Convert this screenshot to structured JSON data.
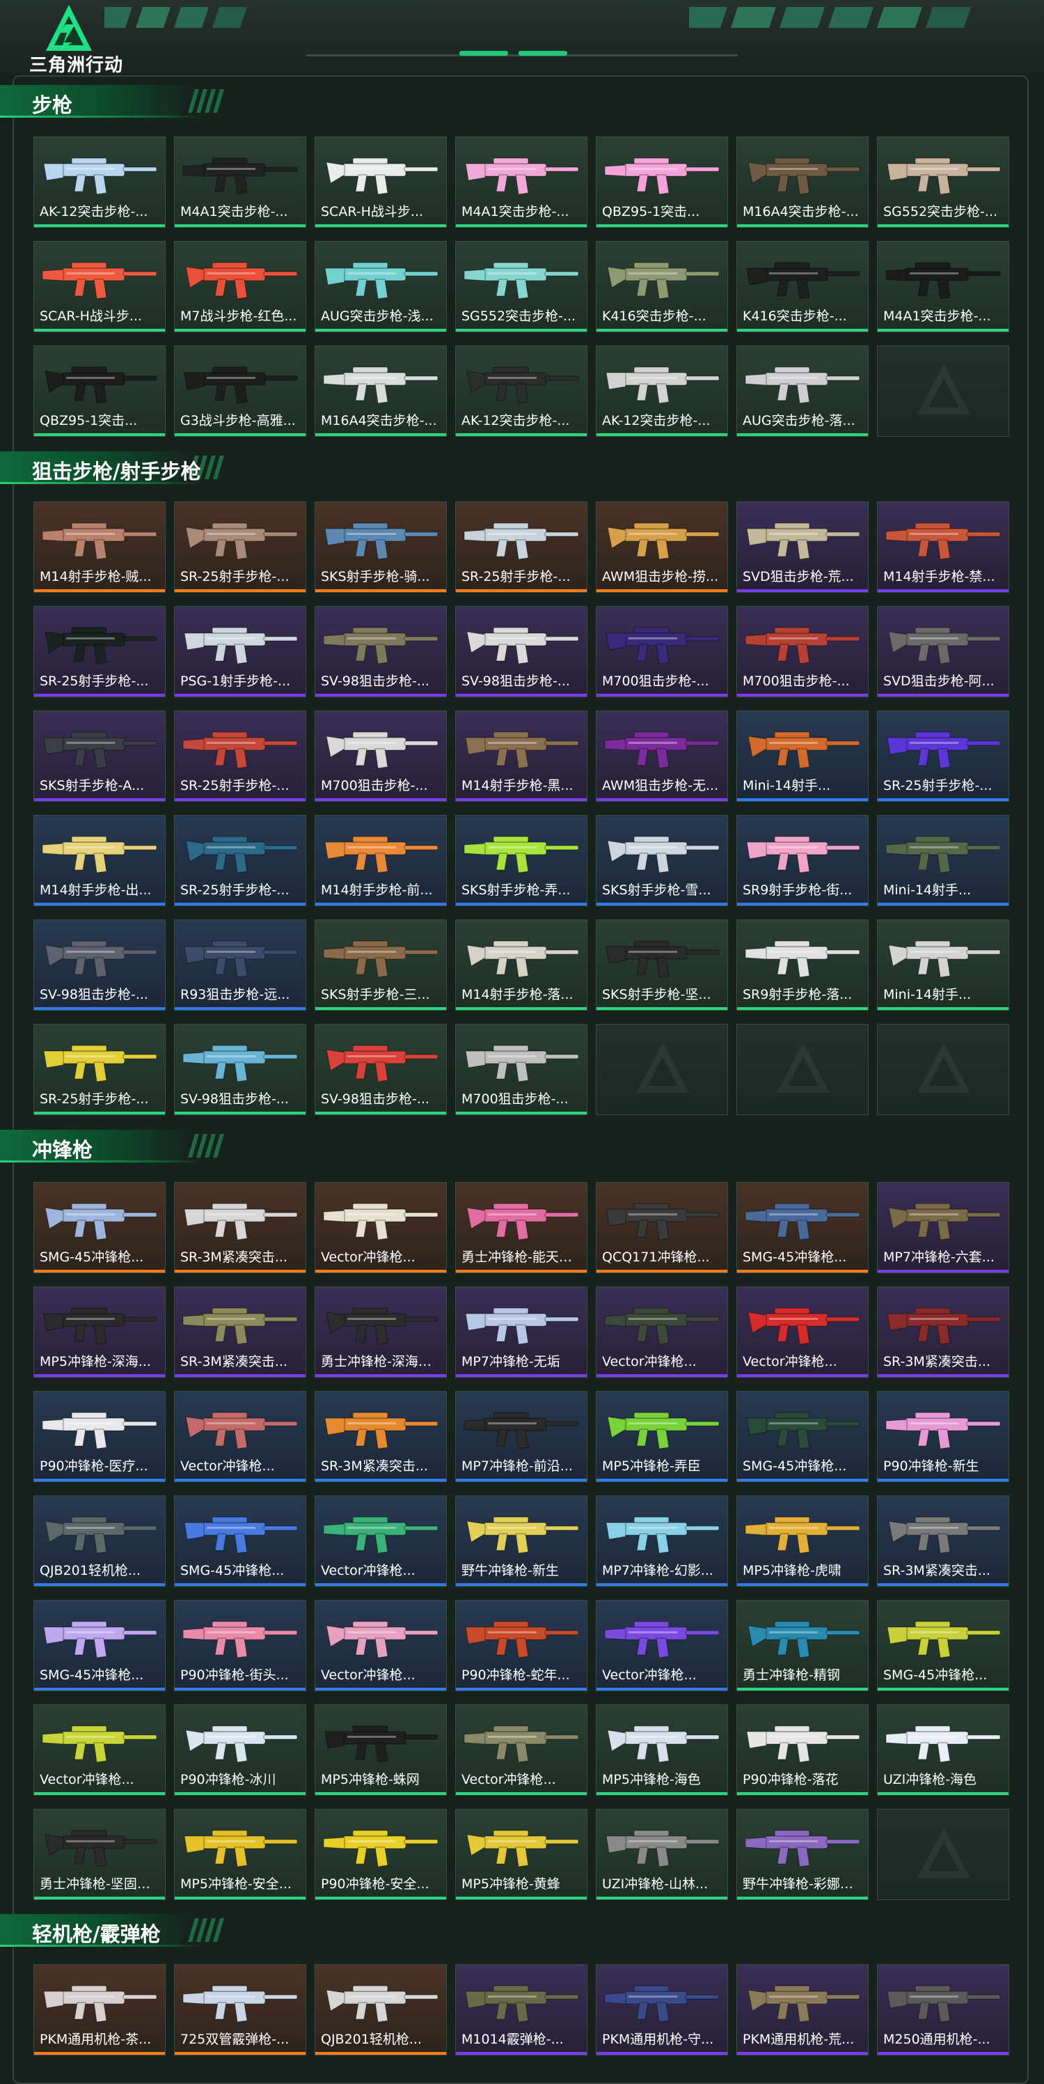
{
  "brand": {
    "logo_text": "三角洲行动"
  },
  "colors": {
    "green": "#2ed37e",
    "orange": "#ff7a18",
    "purple": "#7a3cf0",
    "blue": "#2f7cf0",
    "accent": "#1fe085"
  },
  "sections": [
    {
      "title": "步枪",
      "items": [
        {
          "label": "AK-12突击步枪-...",
          "rarity": "green",
          "color": "#b9d6ee"
        },
        {
          "label": "M4A1突击步枪-...",
          "rarity": "green",
          "color": "#202224"
        },
        {
          "label": "SCAR-H战斗步...",
          "rarity": "green",
          "color": "#e8ecec"
        },
        {
          "label": "M4A1突击步枪-...",
          "rarity": "green",
          "color": "#f0a8d6"
        },
        {
          "label": "QBZ95-1突击...",
          "rarity": "green",
          "color": "#f4a4d8"
        },
        {
          "label": "M16A4突击步枪-...",
          "rarity": "green",
          "color": "#6f5b44"
        },
        {
          "label": "SG552突击步枪-...",
          "rarity": "green",
          "color": "#c9b39e"
        },
        {
          "label": "SCAR-H战斗步...",
          "rarity": "green",
          "color": "#ee5a3f"
        },
        {
          "label": "M7战斗步枪-红色...",
          "rarity": "green",
          "color": "#e94f3a"
        },
        {
          "label": "AUG突击步枪-浅...",
          "rarity": "green",
          "color": "#74d1d1"
        },
        {
          "label": "SG552突击步枪-...",
          "rarity": "green",
          "color": "#86d6cf"
        },
        {
          "label": "K416突击步枪-...",
          "rarity": "green",
          "color": "#8d9a72"
        },
        {
          "label": "K416突击步枪-...",
          "rarity": "green",
          "color": "#1d1f20"
        },
        {
          "label": "M4A1突击步枪-...",
          "rarity": "green",
          "color": "#1a1c1d"
        },
        {
          "label": "QBZ95-1突击...",
          "rarity": "green",
          "color": "#1b1d1e"
        },
        {
          "label": "G3战斗步枪-高雅...",
          "rarity": "green",
          "color": "#1c1e1f"
        },
        {
          "label": "M16A4突击步枪-...",
          "rarity": "green",
          "color": "#d8dcdc"
        },
        {
          "label": "AK-12突击步枪-...",
          "rarity": "green",
          "color": "#2a2c2d"
        },
        {
          "label": "AK-12突击步枪-...",
          "rarity": "green",
          "color": "#d3d3d6"
        },
        {
          "label": "AUG突击步枪-落...",
          "rarity": "green",
          "color": "#cfcfd3"
        },
        {
          "label": "",
          "rarity": "empty",
          "color": ""
        }
      ]
    },
    {
      "title": "狙击步枪/射手步枪",
      "items": [
        {
          "label": "M14射手步枪-贼...",
          "rarity": "orange",
          "color": "#b9826c"
        },
        {
          "label": "SR-25射手步枪-...",
          "rarity": "orange",
          "color": "#a88b78"
        },
        {
          "label": "SKS射手步枪-骑...",
          "rarity": "orange",
          "color": "#5c88b2"
        },
        {
          "label": "SR-25射手步枪-...",
          "rarity": "orange",
          "color": "#c9d3dc"
        },
        {
          "label": "AWM狙击步枪-捞...",
          "rarity": "orange",
          "color": "#d7a04b"
        },
        {
          "label": "SVD狙击步枪-荒...",
          "rarity": "purple",
          "color": "#c2b89c"
        },
        {
          "label": "M14射手步枪-禁...",
          "rarity": "purple",
          "color": "#c7563b"
        },
        {
          "label": "SR-25射手步枪-...",
          "rarity": "purple",
          "color": "#19231f"
        },
        {
          "label": "PSG-1射手步枪-...",
          "rarity": "purple",
          "color": "#cfd7de"
        },
        {
          "label": "SV-98狙击步枪-...",
          "rarity": "purple",
          "color": "#7e7a5c"
        },
        {
          "label": "SV-98狙击步枪-...",
          "rarity": "purple",
          "color": "#dadada"
        },
        {
          "label": "M700狙击步枪-...",
          "rarity": "purple",
          "color": "#3a2b7a"
        },
        {
          "label": "M700狙击步枪-...",
          "rarity": "purple",
          "color": "#b64034"
        },
        {
          "label": "SVD狙击步枪-阿...",
          "rarity": "purple",
          "color": "#6a6a6a"
        },
        {
          "label": "SKS射手步枪-A...",
          "rarity": "purple",
          "color": "#3a3e46"
        },
        {
          "label": "SR-25射手步枪-...",
          "rarity": "purple",
          "color": "#c4473a"
        },
        {
          "label": "M700狙击步枪-...",
          "rarity": "purple",
          "color": "#d9d9d9"
        },
        {
          "label": "M14射手步枪-黑...",
          "rarity": "purple",
          "color": "#8a7050"
        },
        {
          "label": "AWM狙击步枪-无...",
          "rarity": "purple",
          "color": "#7b2b9a"
        },
        {
          "label": "Mini-14射手...",
          "rarity": "blue",
          "color": "#d36a2e"
        },
        {
          "label": "SR-25射手步枪-...",
          "rarity": "blue",
          "color": "#5b37d8"
        },
        {
          "label": "M14射手步枪-出...",
          "rarity": "blue",
          "color": "#e5d27a"
        },
        {
          "label": "SR-25射手步枪-...",
          "rarity": "blue",
          "color": "#2d6a8a"
        },
        {
          "label": "M14射手步枪-前...",
          "rarity": "blue",
          "color": "#e88a3a"
        },
        {
          "label": "SKS射手步枪-弄...",
          "rarity": "blue",
          "color": "#a8e43c"
        },
        {
          "label": "SKS射手步枪-雪...",
          "rarity": "blue",
          "color": "#cfd6e0"
        },
        {
          "label": "SR9射手步枪-街...",
          "rarity": "blue",
          "color": "#f0a4c8"
        },
        {
          "label": "Mini-14射手...",
          "rarity": "blue",
          "color": "#55684a"
        },
        {
          "label": "SV-98狙击步枪-...",
          "rarity": "blue",
          "color": "#5e6270"
        },
        {
          "label": "R93狙击步枪-远...",
          "rarity": "blue",
          "color": "#3d4a6a"
        },
        {
          "label": "SKS射手步枪-三...",
          "rarity": "green",
          "color": "#8a6a4a"
        },
        {
          "label": "M14射手步枪-落...",
          "rarity": "green",
          "color": "#d6d2c8"
        },
        {
          "label": "SKS射手步枪-坚...",
          "rarity": "green",
          "color": "#2a2a2a"
        },
        {
          "label": "SR9射手步枪-落...",
          "rarity": "green",
          "color": "#e1e1e1"
        },
        {
          "label": "Mini-14射手...",
          "rarity": "green",
          "color": "#d4d4d4"
        },
        {
          "label": "SR-25射手步枪-...",
          "rarity": "green",
          "color": "#e3cf3a"
        },
        {
          "label": "SV-98狙击步枪-...",
          "rarity": "green",
          "color": "#6ab4d6"
        },
        {
          "label": "SV-98狙击步枪-...",
          "rarity": "green",
          "color": "#d8423a"
        },
        {
          "label": "M700狙击步枪-...",
          "rarity": "green",
          "color": "#bfbfbf"
        },
        {
          "label": "",
          "rarity": "empty",
          "color": ""
        },
        {
          "label": "",
          "rarity": "empty",
          "color": ""
        },
        {
          "label": "",
          "rarity": "empty",
          "color": ""
        }
      ]
    },
    {
      "title": "冲锋枪",
      "items": [
        {
          "label": "SMG-45冲锋枪...",
          "rarity": "orange",
          "color": "#9fb5dc"
        },
        {
          "label": "SR-3M紧凑突击...",
          "rarity": "orange",
          "color": "#d8d6d6"
        },
        {
          "label": "Vector冲锋枪...",
          "rarity": "orange",
          "color": "#e6e0d0"
        },
        {
          "label": "勇士冲锋枪-能天使...",
          "rarity": "orange",
          "color": "#e26da2"
        },
        {
          "label": "QCQ171冲锋枪...",
          "rarity": "orange",
          "color": "#3a3b3c"
        },
        {
          "label": "SMG-45冲锋枪...",
          "rarity": "orange",
          "color": "#4a6a9a"
        },
        {
          "label": "MP7冲锋枪-六套...",
          "rarity": "purple",
          "color": "#7a6a4a"
        },
        {
          "label": "MP5冲锋枪-深海...",
          "rarity": "purple",
          "color": "#2a2a2c"
        },
        {
          "label": "SR-3M紧凑突击...",
          "rarity": "purple",
          "color": "#8a8a5a"
        },
        {
          "label": "勇士冲锋枪-深海恐...",
          "rarity": "purple",
          "color": "#2b2c2e"
        },
        {
          "label": "MP7冲锋枪-无垢",
          "rarity": "purple",
          "color": "#b7c8e6"
        },
        {
          "label": "Vector冲锋枪...",
          "rarity": "purple",
          "color": "#3b4a3b"
        },
        {
          "label": "Vector冲锋枪...",
          "rarity": "purple",
          "color": "#d62b2b"
        },
        {
          "label": "SR-3M紧凑突击...",
          "rarity": "purple",
          "color": "#8b2a2a"
        },
        {
          "label": "P90冲锋枪-医疗...",
          "rarity": "blue",
          "color": "#e8e8ec"
        },
        {
          "label": "Vector冲锋枪...",
          "rarity": "blue",
          "color": "#c46a6a"
        },
        {
          "label": "SR-3M紧凑突击...",
          "rarity": "blue",
          "color": "#e58a2e"
        },
        {
          "label": "MP7冲锋枪-前沿...",
          "rarity": "blue",
          "color": "#2a2a2a"
        },
        {
          "label": "MP5冲锋枪-弄臣",
          "rarity": "blue",
          "color": "#7ad23a"
        },
        {
          "label": "SMG-45冲锋枪...",
          "rarity": "blue",
          "color": "#2a4a3a"
        },
        {
          "label": "P90冲锋枪-新生",
          "rarity": "blue",
          "color": "#e89ad6"
        },
        {
          "label": "QJB201轻机枪...",
          "rarity": "blue",
          "color": "#5a6a6a"
        },
        {
          "label": "SMG-45冲锋枪...",
          "rarity": "blue",
          "color": "#4a7ae0"
        },
        {
          "label": "Vector冲锋枪...",
          "rarity": "blue",
          "color": "#3ab37a"
        },
        {
          "label": "野牛冲锋枪-新生",
          "rarity": "blue",
          "color": "#e0d05a"
        },
        {
          "label": "MP7冲锋枪-幻影...",
          "rarity": "blue",
          "color": "#8ad0e6"
        },
        {
          "label": "MP5冲锋枪-虎啸",
          "rarity": "blue",
          "color": "#e2b03a"
        },
        {
          "label": "SR-3M紧凑突击...",
          "rarity": "blue",
          "color": "#7a7a7a"
        },
        {
          "label": "SMG-45冲锋枪...",
          "rarity": "blue",
          "color": "#c0a8f0"
        },
        {
          "label": "P90冲锋枪-街头...",
          "rarity": "blue",
          "color": "#e88aa8"
        },
        {
          "label": "Vector冲锋枪...",
          "rarity": "blue",
          "color": "#e8a0c0"
        },
        {
          "label": "P90冲锋枪-蛇年...",
          "rarity": "blue",
          "color": "#c94a2a"
        },
        {
          "label": "Vector冲锋枪...",
          "rarity": "blue",
          "color": "#7a4ae0"
        },
        {
          "label": "勇士冲锋枪-精钢",
          "rarity": "green",
          "color": "#2a8ab0"
        },
        {
          "label": "SMG-45冲锋枪...",
          "rarity": "green",
          "color": "#c8d03a"
        },
        {
          "label": "Vector冲锋枪...",
          "rarity": "green",
          "color": "#c8d63a"
        },
        {
          "label": "P90冲锋枪-冰川",
          "rarity": "green",
          "color": "#d8e6f0"
        },
        {
          "label": "MP5冲锋枪-蛛网",
          "rarity": "green",
          "color": "#1e2022"
        },
        {
          "label": "Vector冲锋枪...",
          "rarity": "green",
          "color": "#8a8a6a"
        },
        {
          "label": "MP5冲锋枪-海色",
          "rarity": "green",
          "color": "#d8e0ee"
        },
        {
          "label": "P90冲锋枪-落花",
          "rarity": "green",
          "color": "#e6e6e6"
        },
        {
          "label": "UZI冲锋枪-海色",
          "rarity": "green",
          "color": "#e8eef6"
        },
        {
          "label": "勇士冲锋枪-坚固材...",
          "rarity": "green",
          "color": "#2a2a2a"
        },
        {
          "label": "MP5冲锋枪-安全...",
          "rarity": "green",
          "color": "#e6c22a"
        },
        {
          "label": "P90冲锋枪-安全...",
          "rarity": "green",
          "color": "#e8d02a"
        },
        {
          "label": "MP5冲锋枪-黄蜂",
          "rarity": "green",
          "color": "#e3c83a"
        },
        {
          "label": "UZI冲锋枪-山林...",
          "rarity": "green",
          "color": "#8a8a8a"
        },
        {
          "label": "野牛冲锋枪-彩娜唤...",
          "rarity": "green",
          "color": "#8a6ac0"
        },
        {
          "label": "",
          "rarity": "empty",
          "color": ""
        }
      ]
    },
    {
      "title": "轻机枪/霰弹枪",
      "items": [
        {
          "label": "PKM通用机枪-茶...",
          "rarity": "orange",
          "color": "#d8d0d0"
        },
        {
          "label": "725双管霰弹枪-...",
          "rarity": "orange",
          "color": "#c8d6e6"
        },
        {
          "label": "QJB201轻机枪...",
          "rarity": "orange",
          "color": "#d6d6d6"
        },
        {
          "label": "M1014霰弹枪-...",
          "rarity": "purple",
          "color": "#6a6a4a"
        },
        {
          "label": "PKM通用机枪-守...",
          "rarity": "purple",
          "color": "#3a4a8a"
        },
        {
          "label": "PKM通用机枪-荒...",
          "rarity": "purple",
          "color": "#8a7a5a"
        },
        {
          "label": "M250通用机枪-...",
          "rarity": "purple",
          "color": "#5a5a5a"
        }
      ]
    }
  ]
}
